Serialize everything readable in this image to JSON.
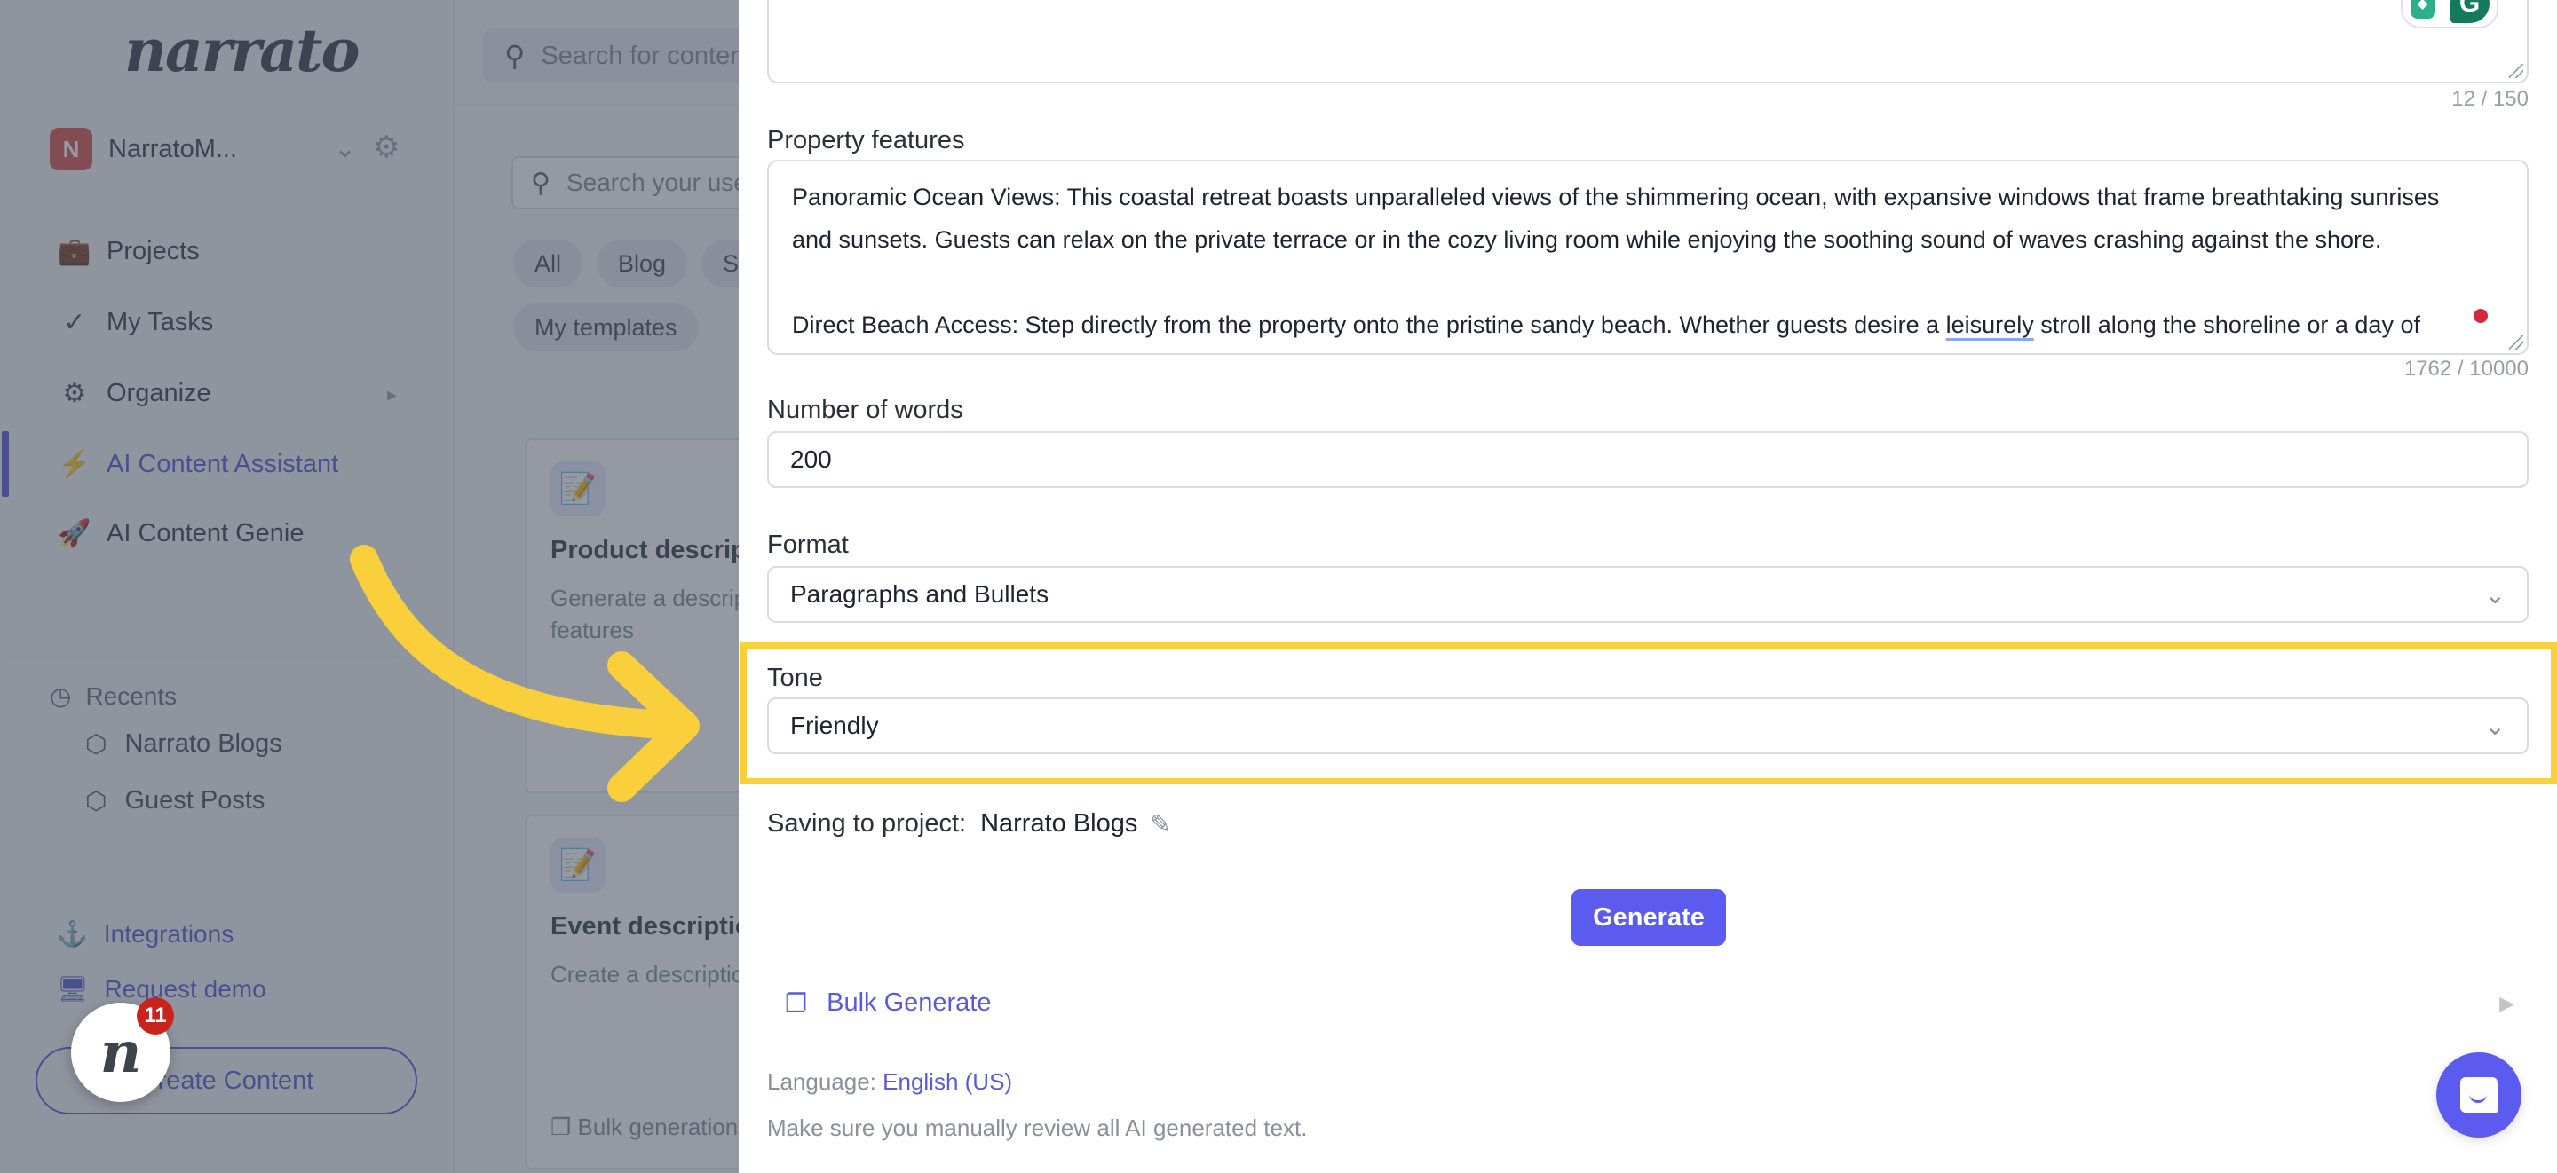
{
  "sidebar": {
    "logo": "narrato",
    "workspace": {
      "initial": "N",
      "name": "NarratoM...",
      "avatar_color": "#d9534f"
    },
    "nav": [
      {
        "label": "Projects",
        "icon": "briefcase-icon"
      },
      {
        "label": "My Tasks",
        "icon": "double-check-icon"
      },
      {
        "label": "Organize",
        "icon": "gears-icon"
      },
      {
        "label": "AI Content Assistant",
        "icon": "lightning-icon",
        "active": true
      },
      {
        "label": "AI Content Genie",
        "icon": "rocket-icon"
      }
    ],
    "recents": {
      "heading": "Recents",
      "items": [
        {
          "label": "Narrato Blogs",
          "icon": "cube-icon"
        },
        {
          "label": "Guest Posts",
          "icon": "cube-icon"
        }
      ]
    },
    "links": [
      {
        "label": "Integrations",
        "icon": "anchor-icon"
      },
      {
        "label": "Request demo",
        "icon": "monitor-icon"
      }
    ],
    "create_button": "Create Content",
    "accent_color": "#5b5bd6"
  },
  "main": {
    "global_search_placeholder": "Search for content",
    "template_search_placeholder": "Search your use case",
    "filters": [
      "All",
      "Blog",
      "S",
      "My templates"
    ],
    "cards": [
      {
        "title": "Product description",
        "description": "Generate a description for a product and features",
        "footer": ""
      },
      {
        "title": "Event description",
        "description": "Create a description",
        "footer": "Bulk generation"
      }
    ]
  },
  "drawer": {
    "top_field": {
      "counter": "12 / 150"
    },
    "property_features": {
      "label": "Property features",
      "paragraphs": [
        "Panoramic Ocean Views: This coastal retreat boasts unparalleled views of the shimmering ocean, with expansive windows that frame breathtaking sunrises and sunsets. Guests can relax on the private terrace or in the cozy living room while enjoying the soothing sound of waves crashing against the shore.",
        "",
        "Direct Beach Access: Step directly from the property onto the pristine sandy beach. Whether guests desire a ",
        "leisurely",
        " stroll along the shoreline or a day of"
      ],
      "counter": "1762 / 10000"
    },
    "number_of_words": {
      "label": "Number of words",
      "value": "200"
    },
    "format": {
      "label": "Format",
      "value": "Paragraphs and Bullets"
    },
    "tone": {
      "label": "Tone",
      "value": "Friendly"
    },
    "saving": {
      "label": "Saving to project:",
      "project": "Narrato Blogs"
    },
    "generate_button": "Generate",
    "bulk_generate": "Bulk Generate",
    "language": {
      "label": "Language:",
      "value": "English (US)"
    },
    "disclaimer": "Make sure you manually review all AI generated text.",
    "highlight_color": "#f9cf3c",
    "button_color": "#5b5bf0"
  },
  "launcher": {
    "letter": "n",
    "badge": "11"
  }
}
